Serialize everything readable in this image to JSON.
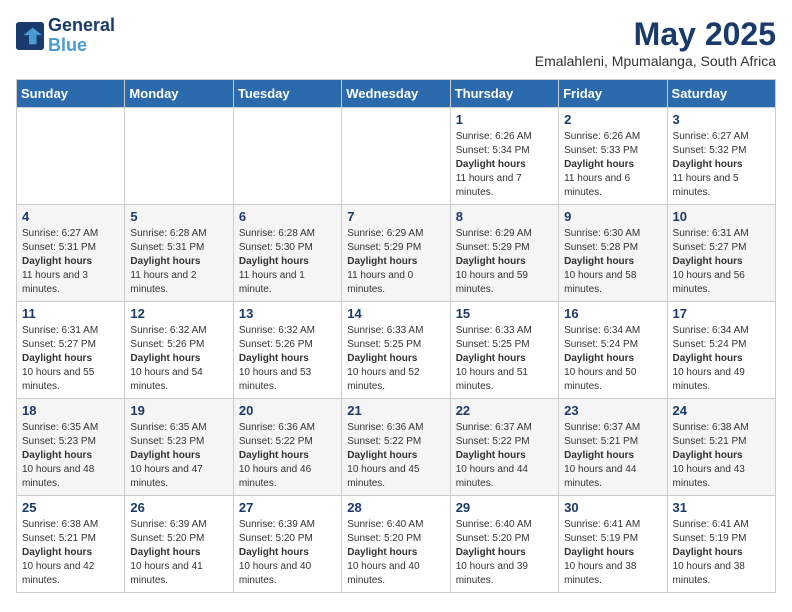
{
  "header": {
    "logo_line1": "General",
    "logo_line2": "Blue",
    "month_title": "May 2025",
    "subtitle": "Emalahleni, Mpumalanga, South Africa"
  },
  "weekdays": [
    "Sunday",
    "Monday",
    "Tuesday",
    "Wednesday",
    "Thursday",
    "Friday",
    "Saturday"
  ],
  "weeks": [
    [
      {
        "day": "",
        "sunrise": "",
        "sunset": "",
        "daylight": ""
      },
      {
        "day": "",
        "sunrise": "",
        "sunset": "",
        "daylight": ""
      },
      {
        "day": "",
        "sunrise": "",
        "sunset": "",
        "daylight": ""
      },
      {
        "day": "",
        "sunrise": "",
        "sunset": "",
        "daylight": ""
      },
      {
        "day": "1",
        "sunrise": "Sunrise: 6:26 AM",
        "sunset": "Sunset: 5:34 PM",
        "daylight": "Daylight: 11 hours and 7 minutes."
      },
      {
        "day": "2",
        "sunrise": "Sunrise: 6:26 AM",
        "sunset": "Sunset: 5:33 PM",
        "daylight": "Daylight: 11 hours and 6 minutes."
      },
      {
        "day": "3",
        "sunrise": "Sunrise: 6:27 AM",
        "sunset": "Sunset: 5:32 PM",
        "daylight": "Daylight: 11 hours and 5 minutes."
      }
    ],
    [
      {
        "day": "4",
        "sunrise": "Sunrise: 6:27 AM",
        "sunset": "Sunset: 5:31 PM",
        "daylight": "Daylight: 11 hours and 3 minutes."
      },
      {
        "day": "5",
        "sunrise": "Sunrise: 6:28 AM",
        "sunset": "Sunset: 5:31 PM",
        "daylight": "Daylight: 11 hours and 2 minutes."
      },
      {
        "day": "6",
        "sunrise": "Sunrise: 6:28 AM",
        "sunset": "Sunset: 5:30 PM",
        "daylight": "Daylight: 11 hours and 1 minute."
      },
      {
        "day": "7",
        "sunrise": "Sunrise: 6:29 AM",
        "sunset": "Sunset: 5:29 PM",
        "daylight": "Daylight: 11 hours and 0 minutes."
      },
      {
        "day": "8",
        "sunrise": "Sunrise: 6:29 AM",
        "sunset": "Sunset: 5:29 PM",
        "daylight": "Daylight: 10 hours and 59 minutes."
      },
      {
        "day": "9",
        "sunrise": "Sunrise: 6:30 AM",
        "sunset": "Sunset: 5:28 PM",
        "daylight": "Daylight: 10 hours and 58 minutes."
      },
      {
        "day": "10",
        "sunrise": "Sunrise: 6:31 AM",
        "sunset": "Sunset: 5:27 PM",
        "daylight": "Daylight: 10 hours and 56 minutes."
      }
    ],
    [
      {
        "day": "11",
        "sunrise": "Sunrise: 6:31 AM",
        "sunset": "Sunset: 5:27 PM",
        "daylight": "Daylight: 10 hours and 55 minutes."
      },
      {
        "day": "12",
        "sunrise": "Sunrise: 6:32 AM",
        "sunset": "Sunset: 5:26 PM",
        "daylight": "Daylight: 10 hours and 54 minutes."
      },
      {
        "day": "13",
        "sunrise": "Sunrise: 6:32 AM",
        "sunset": "Sunset: 5:26 PM",
        "daylight": "Daylight: 10 hours and 53 minutes."
      },
      {
        "day": "14",
        "sunrise": "Sunrise: 6:33 AM",
        "sunset": "Sunset: 5:25 PM",
        "daylight": "Daylight: 10 hours and 52 minutes."
      },
      {
        "day": "15",
        "sunrise": "Sunrise: 6:33 AM",
        "sunset": "Sunset: 5:25 PM",
        "daylight": "Daylight: 10 hours and 51 minutes."
      },
      {
        "day": "16",
        "sunrise": "Sunrise: 6:34 AM",
        "sunset": "Sunset: 5:24 PM",
        "daylight": "Daylight: 10 hours and 50 minutes."
      },
      {
        "day": "17",
        "sunrise": "Sunrise: 6:34 AM",
        "sunset": "Sunset: 5:24 PM",
        "daylight": "Daylight: 10 hours and 49 minutes."
      }
    ],
    [
      {
        "day": "18",
        "sunrise": "Sunrise: 6:35 AM",
        "sunset": "Sunset: 5:23 PM",
        "daylight": "Daylight: 10 hours and 48 minutes."
      },
      {
        "day": "19",
        "sunrise": "Sunrise: 6:35 AM",
        "sunset": "Sunset: 5:23 PM",
        "daylight": "Daylight: 10 hours and 47 minutes."
      },
      {
        "day": "20",
        "sunrise": "Sunrise: 6:36 AM",
        "sunset": "Sunset: 5:22 PM",
        "daylight": "Daylight: 10 hours and 46 minutes."
      },
      {
        "day": "21",
        "sunrise": "Sunrise: 6:36 AM",
        "sunset": "Sunset: 5:22 PM",
        "daylight": "Daylight: 10 hours and 45 minutes."
      },
      {
        "day": "22",
        "sunrise": "Sunrise: 6:37 AM",
        "sunset": "Sunset: 5:22 PM",
        "daylight": "Daylight: 10 hours and 44 minutes."
      },
      {
        "day": "23",
        "sunrise": "Sunrise: 6:37 AM",
        "sunset": "Sunset: 5:21 PM",
        "daylight": "Daylight: 10 hours and 44 minutes."
      },
      {
        "day": "24",
        "sunrise": "Sunrise: 6:38 AM",
        "sunset": "Sunset: 5:21 PM",
        "daylight": "Daylight: 10 hours and 43 minutes."
      }
    ],
    [
      {
        "day": "25",
        "sunrise": "Sunrise: 6:38 AM",
        "sunset": "Sunset: 5:21 PM",
        "daylight": "Daylight: 10 hours and 42 minutes."
      },
      {
        "day": "26",
        "sunrise": "Sunrise: 6:39 AM",
        "sunset": "Sunset: 5:20 PM",
        "daylight": "Daylight: 10 hours and 41 minutes."
      },
      {
        "day": "27",
        "sunrise": "Sunrise: 6:39 AM",
        "sunset": "Sunset: 5:20 PM",
        "daylight": "Daylight: 10 hours and 40 minutes."
      },
      {
        "day": "28",
        "sunrise": "Sunrise: 6:40 AM",
        "sunset": "Sunset: 5:20 PM",
        "daylight": "Daylight: 10 hours and 40 minutes."
      },
      {
        "day": "29",
        "sunrise": "Sunrise: 6:40 AM",
        "sunset": "Sunset: 5:20 PM",
        "daylight": "Daylight: 10 hours and 39 minutes."
      },
      {
        "day": "30",
        "sunrise": "Sunrise: 6:41 AM",
        "sunset": "Sunset: 5:19 PM",
        "daylight": "Daylight: 10 hours and 38 minutes."
      },
      {
        "day": "31",
        "sunrise": "Sunrise: 6:41 AM",
        "sunset": "Sunset: 5:19 PM",
        "daylight": "Daylight: 10 hours and 38 minutes."
      }
    ]
  ]
}
